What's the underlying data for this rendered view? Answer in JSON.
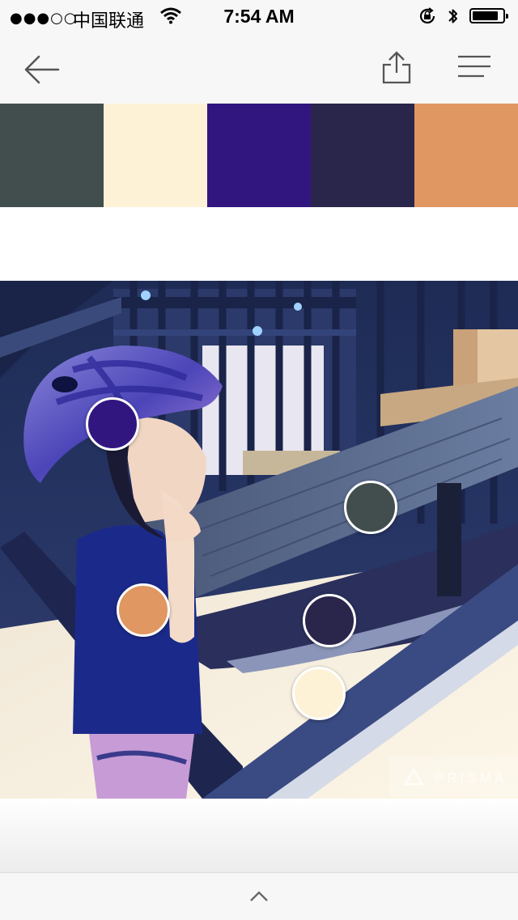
{
  "status_bar": {
    "signal": "●●●○○",
    "carrier": "中国联通",
    "time": "7:54 AM",
    "battery_level": 0.85,
    "icons": [
      "wifi-icon",
      "rotation-lock-icon",
      "bluetooth-icon",
      "battery-icon"
    ]
  },
  "nav": {
    "icons": [
      "back-arrow-icon",
      "share-icon",
      "menu-icon"
    ]
  },
  "palette": [
    {
      "hex": "#414e4d"
    },
    {
      "hex": "#fdf2d6"
    },
    {
      "hex": "#321680"
    },
    {
      "hex": "#2a254b"
    },
    {
      "hex": "#e09762"
    }
  ],
  "photo": {
    "watermark": "PRISMA",
    "watermark_icon": "prisma-triangle-icon"
  },
  "bottom_bar": {
    "icon": "chevron-up-icon"
  }
}
